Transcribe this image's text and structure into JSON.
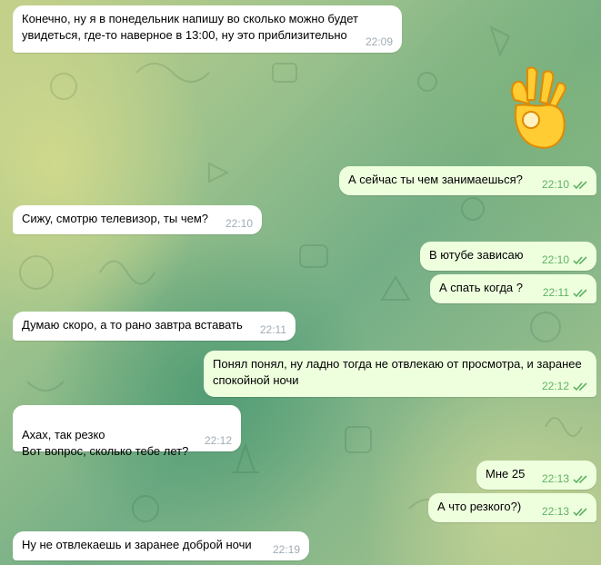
{
  "chat": {
    "sticker": {
      "icon": "ok-hand-emoji"
    },
    "messages": [
      {
        "text": "Конечно, ну я в понедельник напишу во сколько можно будет увидеться, где-то наверное в 13:00, ну это приблизительно",
        "time": "22:09",
        "direction": "incoming"
      },
      {
        "text": "А сейчас ты чем занимаешься?",
        "time": "22:10",
        "direction": "outgoing",
        "status": "read"
      },
      {
        "text": "Сижу, смотрю телевизор, ты чем?",
        "time": "22:10",
        "direction": "incoming"
      },
      {
        "text": "В ютубе зависаю",
        "time": "22:10",
        "direction": "outgoing",
        "status": "read"
      },
      {
        "text": "А спать когда ?",
        "time": "22:11",
        "direction": "outgoing",
        "status": "read"
      },
      {
        "text": "Думаю скоро, а то рано завтра вставать",
        "time": "22:11",
        "direction": "incoming"
      },
      {
        "text": "Понял понял, ну ладно тогда не отвлекаю от просмотра, и заранее спокойной ночи",
        "time": "22:12",
        "direction": "outgoing",
        "status": "read"
      },
      {
        "text": "Ахах, так резко\nВот вопрос, сколько тебе лет?",
        "time": "22:12",
        "direction": "incoming"
      },
      {
        "text": "Мне 25",
        "time": "22:13",
        "direction": "outgoing",
        "status": "read"
      },
      {
        "text": "А что резкого?)",
        "time": "22:13",
        "direction": "outgoing",
        "status": "read"
      },
      {
        "text": "Ну не отвлекаешь и заранее доброй ночи",
        "time": "22:19",
        "direction": "incoming"
      }
    ]
  },
  "colors": {
    "incoming_bubble": "#ffffff",
    "outgoing_bubble": "#eeffde",
    "incoming_time": "#a0acb6",
    "outgoing_time": "#5fb262"
  }
}
